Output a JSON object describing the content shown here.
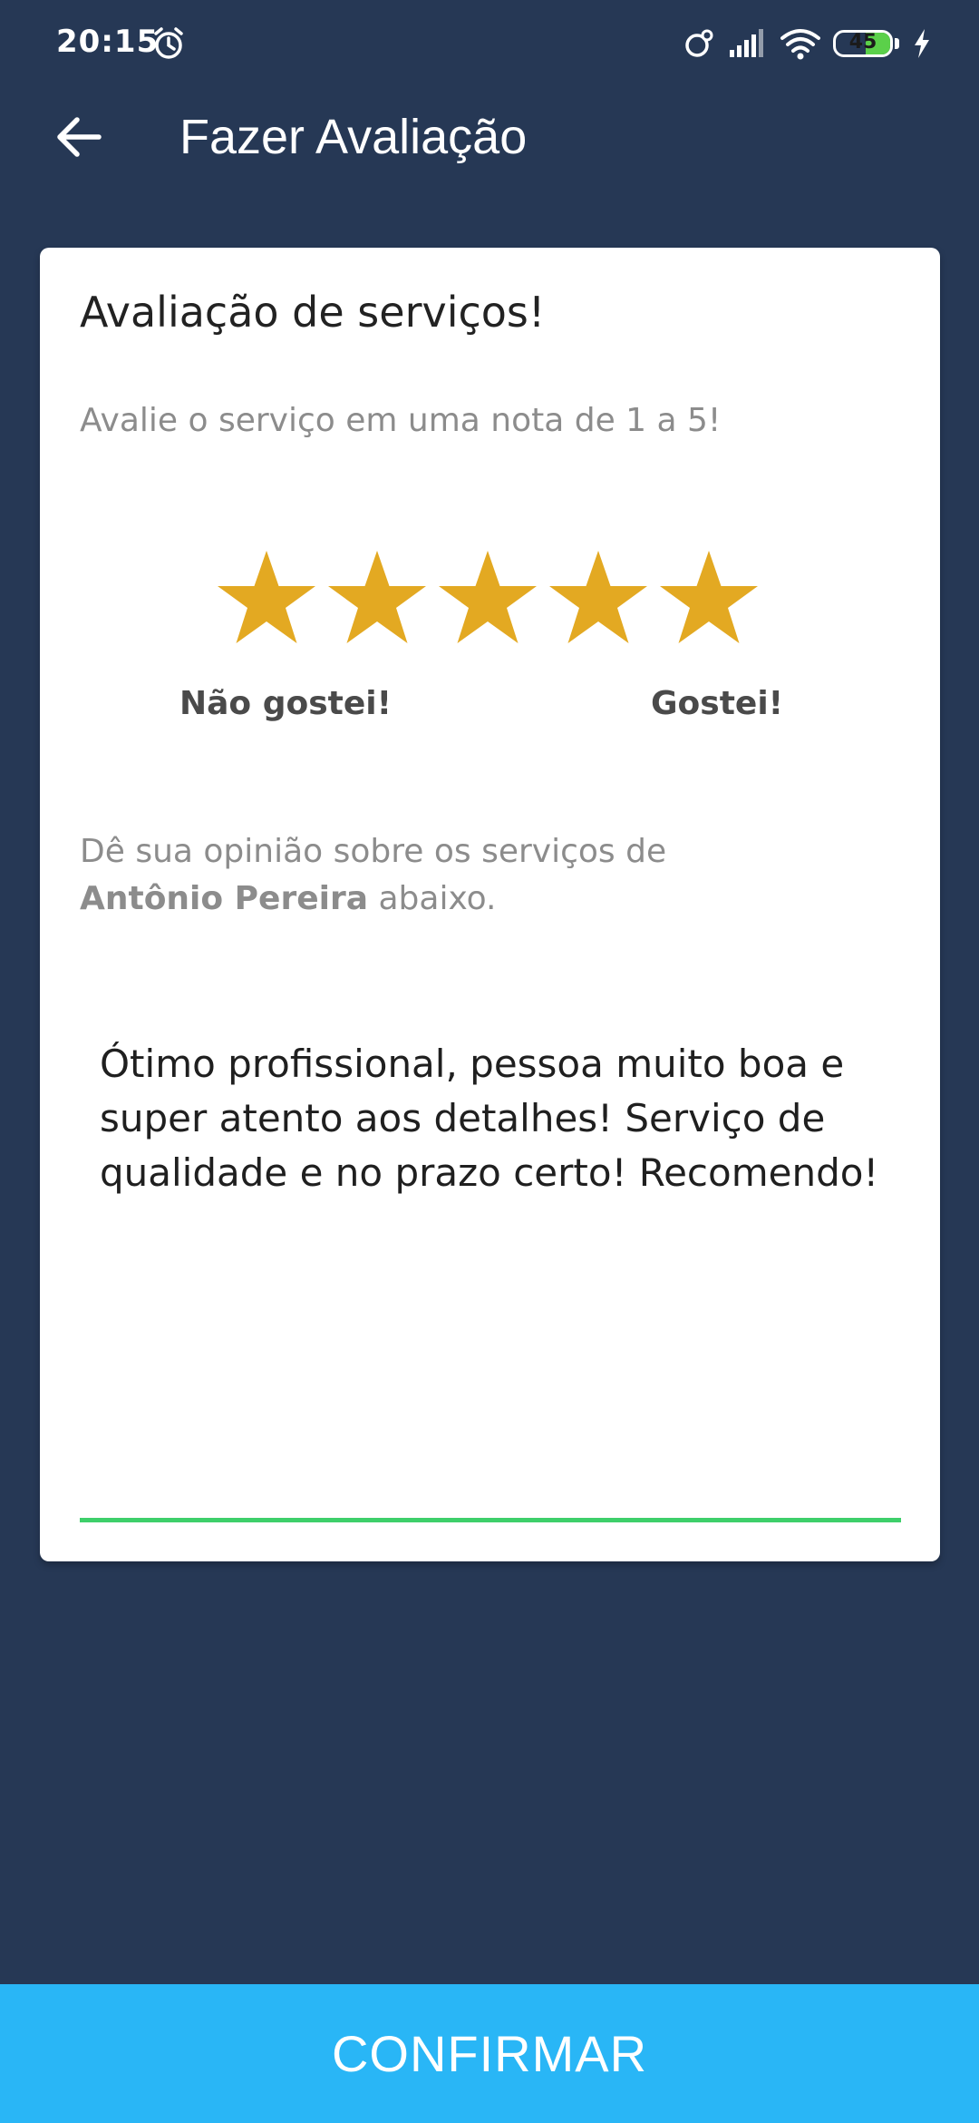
{
  "status_bar": {
    "time": "20:15",
    "battery_level": "45",
    "battery_fraction": 0.45,
    "icons": [
      "alarm-icon",
      "sync-icon",
      "signal-icon",
      "wifi-icon",
      "battery-icon",
      "charging-icon"
    ]
  },
  "app_bar": {
    "title": "Fazer Avaliação",
    "back_icon": "arrow-left-icon"
  },
  "review": {
    "title": "Avaliação de serviços!",
    "subtitle": "Avalie o serviço em uma nota de 1 a 5!",
    "rating": 5,
    "max_rating": 5,
    "label_low": "Não gostei!",
    "label_high": "Gostei!",
    "opinion_prefix": "Dê sua opinião sobre os serviços de",
    "provider_name": "Antônio Pereira",
    "opinion_suffix": "abaixo.",
    "comment": "Ótimo profissional, pessoa muito boa e super atento aos detalhes! Serviço de qualidade e no prazo certo! Recomendo!"
  },
  "confirm_label": "CONFIRMAR",
  "colors": {
    "background": "#263855",
    "star": "#E3A922",
    "underline": "#3ECF6A",
    "confirm": "#29B6F6"
  }
}
